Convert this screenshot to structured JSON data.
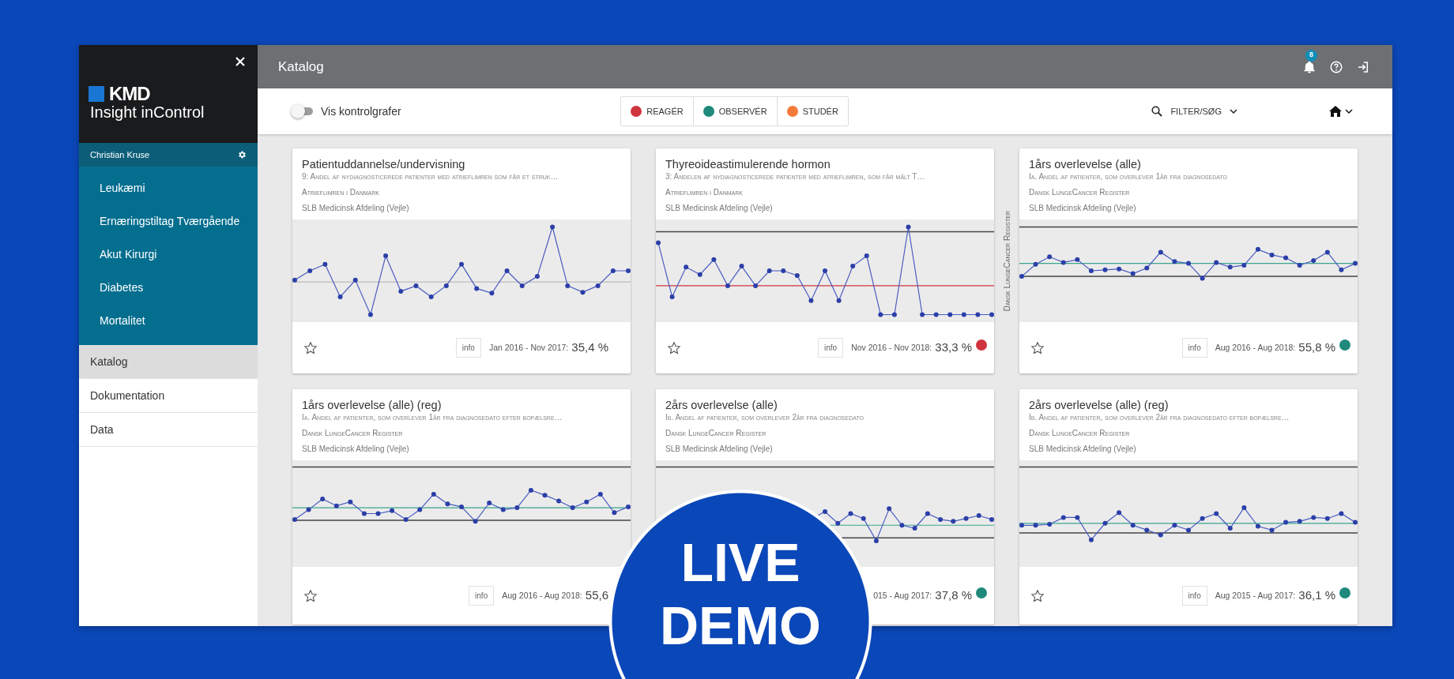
{
  "sidebar": {
    "brand": "KMD",
    "product": "Insight inControl",
    "user": "Christian Kruse",
    "groups": [
      {
        "label": "Leukæmi"
      },
      {
        "label": "Ernæringstiltag Tværgående"
      },
      {
        "label": "Akut Kirurgi"
      },
      {
        "label": "Diabetes"
      },
      {
        "label": "Mortalitet"
      }
    ],
    "nav": [
      {
        "label": "Katalog",
        "selected": true
      },
      {
        "label": "Dokumentation",
        "selected": false
      },
      {
        "label": "Data",
        "selected": false
      }
    ]
  },
  "header": {
    "title": "Katalog",
    "notification_count": "8"
  },
  "toolbar": {
    "toggle": {
      "label": "Vis kontrolgrafer",
      "on": false
    },
    "legend": [
      {
        "label": "REAGÉR",
        "color": "#d0343f"
      },
      {
        "label": "OBSERVÉR",
        "color": "#1f8a7c"
      },
      {
        "label": "STUDÉR",
        "color": "#f47a3c"
      }
    ],
    "filter": "FILTER/SØG"
  },
  "side_label": "Dansk LungeCancer Register",
  "cards": [
    {
      "title": "Patientuddannelse/undervisning",
      "indicator": "9: Andel af nydiagnosticerede patienter med atrieflimren som får et struk…",
      "register": "Atrieflimren i Danmark",
      "department": "SLB Medicinsk Afdeling (Vejle)",
      "favorite": false,
      "info": "info",
      "period": "Jan 2016 - Nov 2017:",
      "value": "35,4 %"
    },
    {
      "title": "Thyreoideastimulerende hormon",
      "indicator": "3: Andelen af nydiagnosticerede patienter med atrieflimren, som får målt T…",
      "register": "Atrieflimren i Danmark",
      "department": "SLB Medicinsk Afdeling (Vejle)",
      "favorite": false,
      "info": "info",
      "period": "Nov 2016 - Nov 2018:",
      "value": "33,3 %",
      "color": "#d0343f"
    },
    {
      "title": "1års overlevelse (alle)",
      "indicator": "Ia. Andel af patienter, som overlever 1år fra diagnosedato",
      "register": "Dansk LungeCancer Register",
      "department": "SLB Medicinsk Afdeling (Vejle)",
      "favorite": false,
      "info": "info",
      "period": "Aug 2016 - Aug 2018:",
      "value": "55,8 %",
      "color": "#1f8a7c"
    },
    {
      "title": "1års overlevelse (alle) (reg)",
      "indicator": "Ia. Andel af patienter, som overlever 1år fra diagnosedato efter bopælsre…",
      "register": "Dansk LungeCancer Register",
      "department": "SLB Medicinsk Afdeling (Vejle)",
      "favorite": false,
      "info": "info",
      "period": "Aug 2016 - Aug 2018:",
      "value": "55,6"
    },
    {
      "title": "2års overlevelse (alle)",
      "indicator": "Ib. Andel af patienter, som overlever 2år fra diagnosedato",
      "register": "Dansk LungeCancer Register",
      "department": "SLB Medicinsk Afdeling (Vejle)",
      "period": "015 - Aug 2017:",
      "value": "37,8 %",
      "color": "#1f8a7c"
    },
    {
      "title": "2års overlevelse (alle) (reg)",
      "indicator": "Ib. Andel af patienter, som overlever 2år fra diagnosedato efter bopælsre…",
      "register": "Dansk LungeCancer Register",
      "department": "SLB Medicinsk Afdeling (Vejle)",
      "favorite": false,
      "info": "info",
      "period": "Aug 2015 - Aug 2017:",
      "value": "36,1 %",
      "color": "#1f8a7c"
    }
  ],
  "overlay": {
    "lines": [
      "LIVE",
      "DEMO"
    ]
  }
}
